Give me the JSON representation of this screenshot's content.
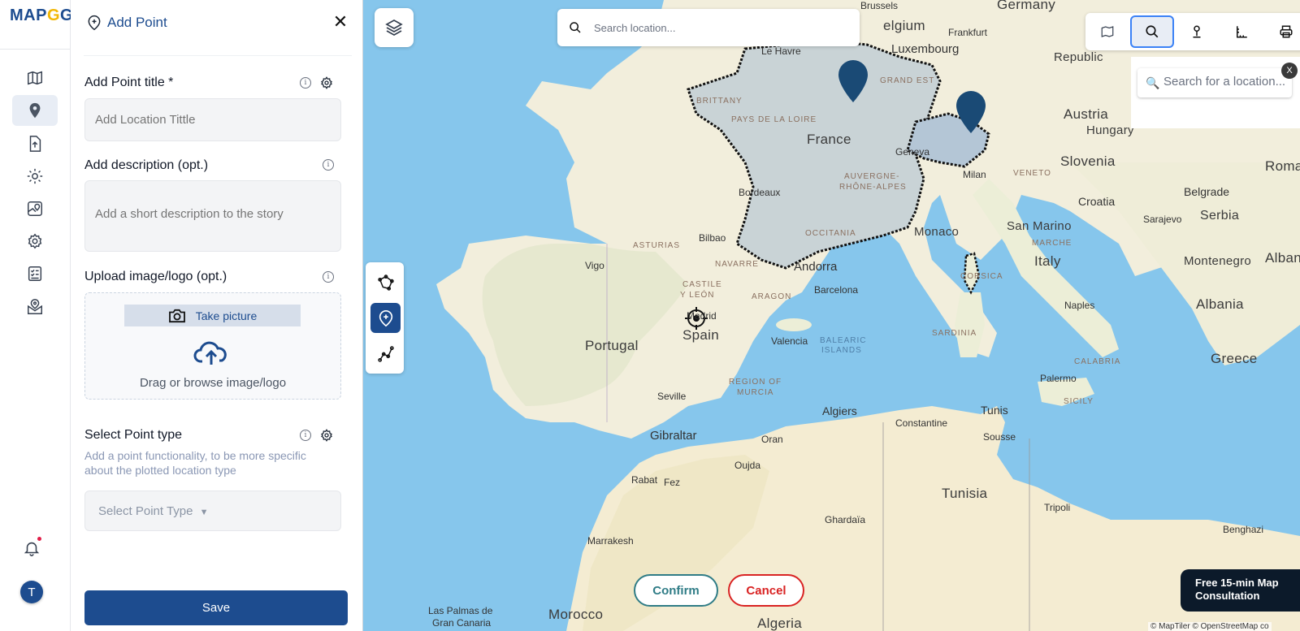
{
  "app": {
    "logo_prefix": "MAP",
    "logo_accent": "G",
    "logo_suffix": "G"
  },
  "panel": {
    "title": "Add Point",
    "title_label": "Add Point title *",
    "title_placeholder": "Add Location Tittle",
    "description_label": "Add description (opt.)",
    "description_placeholder": "Add a short description to the story",
    "upload_label": "Upload image/logo (opt.)",
    "take_picture": "Take picture",
    "drag_text": "Drag or browse image/logo",
    "point_type_label": "Select Point type",
    "point_type_help": "Add a point functionality, to be more specific about the plotted location type",
    "point_type_value": "Select Point Type",
    "save": "Save"
  },
  "user": {
    "initial": "T"
  },
  "map": {
    "search_placeholder": "Search location...",
    "side_search_placeholder": "Search for a location...",
    "confirm": "Confirm",
    "cancel": "Cancel",
    "consult": "Free 15-min Map Consultation",
    "attribution": "© MapTiler © OpenStreetMap co",
    "labels": {
      "belgium": "elgium",
      "germany": "Germany",
      "brussels": "Brussels",
      "frankfurt": "Frankfurt",
      "luxembourg": "Luxembourg",
      "republic": "Republic",
      "le_havre": "Le Havre",
      "grand_est": "GRAND EST",
      "brittany": "BRITTANY",
      "pays_de_la_loire": "PAYS DE LA LOIRE",
      "austria": "Austria",
      "hungary": "Hungary",
      "france": "France",
      "geneva": "Geneva",
      "slovenia": "Slovenia",
      "roman": "Roman",
      "milan": "Milan",
      "veneto": "VENETO",
      "croatia": "Croatia",
      "belgrade": "Belgrade",
      "sarajevo": "Sarajevo",
      "serbia": "Serbia",
      "auvergne": "AUVERGNE-",
      "rhone_alpes": "RHÔNE-ALPES",
      "bordeaux": "Bordeaux",
      "san_marino": "San Marino",
      "marche": "MARCHE",
      "bilbao": "Bilbao",
      "occitania": "OCCITANIA",
      "monaco": "Monaco",
      "asturias": "ASTURIAS",
      "navarre": "NAVARRE",
      "vigo": "Vigo",
      "andorra": "Andorra",
      "montenegro": "Montenegro",
      "italy": "Italy",
      "corsica": "CORSICA",
      "barcelona": "Barcelona",
      "castile": "CASTILE",
      "y_leon": "Y LEÓN",
      "aragon": "ARAGON",
      "madrid": "Madrid",
      "naples": "Naples",
      "albania": "Albania",
      "spain": "Spain",
      "portugal": "Portugal",
      "valencia": "Valencia",
      "balearic": "BALEARIC",
      "islands": "ISLANDS",
      "sardinia": "SARDINIA",
      "calabria": "CALABRIA",
      "greece": "Greece",
      "region_of": "REGION OF",
      "murcia": "MURCIA",
      "palermo": "Palermo",
      "seville": "Seville",
      "sicily": "SICILY",
      "algiers": "Algiers",
      "tunis": "Tunis",
      "gibraltar": "Gibraltar",
      "constantine": "Constantine",
      "oran": "Oran",
      "sousse": "Sousse",
      "oujda": "Oujda",
      "rabat": "Rabat",
      "fez": "Fez",
      "tunisia": "Tunisia",
      "tripoli": "Tripoli",
      "ghardaia": "Ghardaïa",
      "benghazi": "Benghazi",
      "marrakesh": "Marrakesh",
      "las_palmas": "Las Palmas de",
      "gran_canaria": "Gran Canaria",
      "morocco": "Morocco",
      "algeria": "Algeria"
    }
  },
  "colors": {
    "primary": "#1d4c8f",
    "accent": "#f2b705",
    "confirm": "#2f7c86",
    "cancel": "#d92323"
  }
}
